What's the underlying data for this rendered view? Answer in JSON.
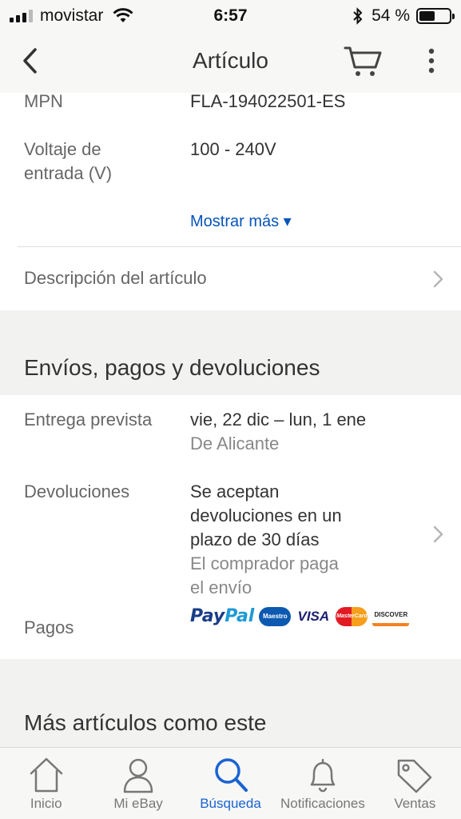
{
  "status_bar": {
    "carrier": "movistar",
    "time": "6:57",
    "battery_percent": "54 %",
    "battery_level": 0.54
  },
  "nav": {
    "title": "Artículo"
  },
  "specs": [
    {
      "label": "MPN",
      "value": "FLA-194022501-ES"
    },
    {
      "label_line1": "Voltaje de",
      "label_line2": "entrada (V)",
      "value": "100 - 240V"
    }
  ],
  "show_more": "Mostrar más ▾",
  "description_row": "Descripción del artículo",
  "shipping_section": {
    "header": "Envíos, pagos y devoluciones",
    "delivery_label": "Entrega prevista",
    "delivery_value": "vie, 22 dic – lun, 1 ene",
    "delivery_origin": "De Alicante",
    "returns_label": "Devoluciones",
    "returns_value_lines": [
      "Se aceptan",
      "devoluciones en un",
      "plazo de 30 días"
    ],
    "returns_note_lines": [
      "El comprador paga",
      "el envío"
    ],
    "payments_label": "Pagos",
    "payment_logos": {
      "paypal_1": "Pay",
      "paypal_2": "Pal",
      "maestro": "Maestro",
      "visa": "VISA",
      "mastercard": "MasterCard",
      "discover": "DISCOVER"
    }
  },
  "more_items_header": "Más artículos como este",
  "tabs": [
    {
      "label": "Inicio",
      "icon": "home-icon",
      "active": false
    },
    {
      "label": "Mi eBay",
      "icon": "user-icon",
      "active": false
    },
    {
      "label": "Búsqueda",
      "icon": "search-icon",
      "active": true
    },
    {
      "label": "Notificaciones",
      "icon": "bell-icon",
      "active": false
    },
    {
      "label": "Ventas",
      "icon": "tag-icon",
      "active": false
    }
  ],
  "colors": {
    "link_blue": "#0654ba",
    "active_tab": "#1a63d1",
    "section_bg": "#f2f2f1"
  }
}
